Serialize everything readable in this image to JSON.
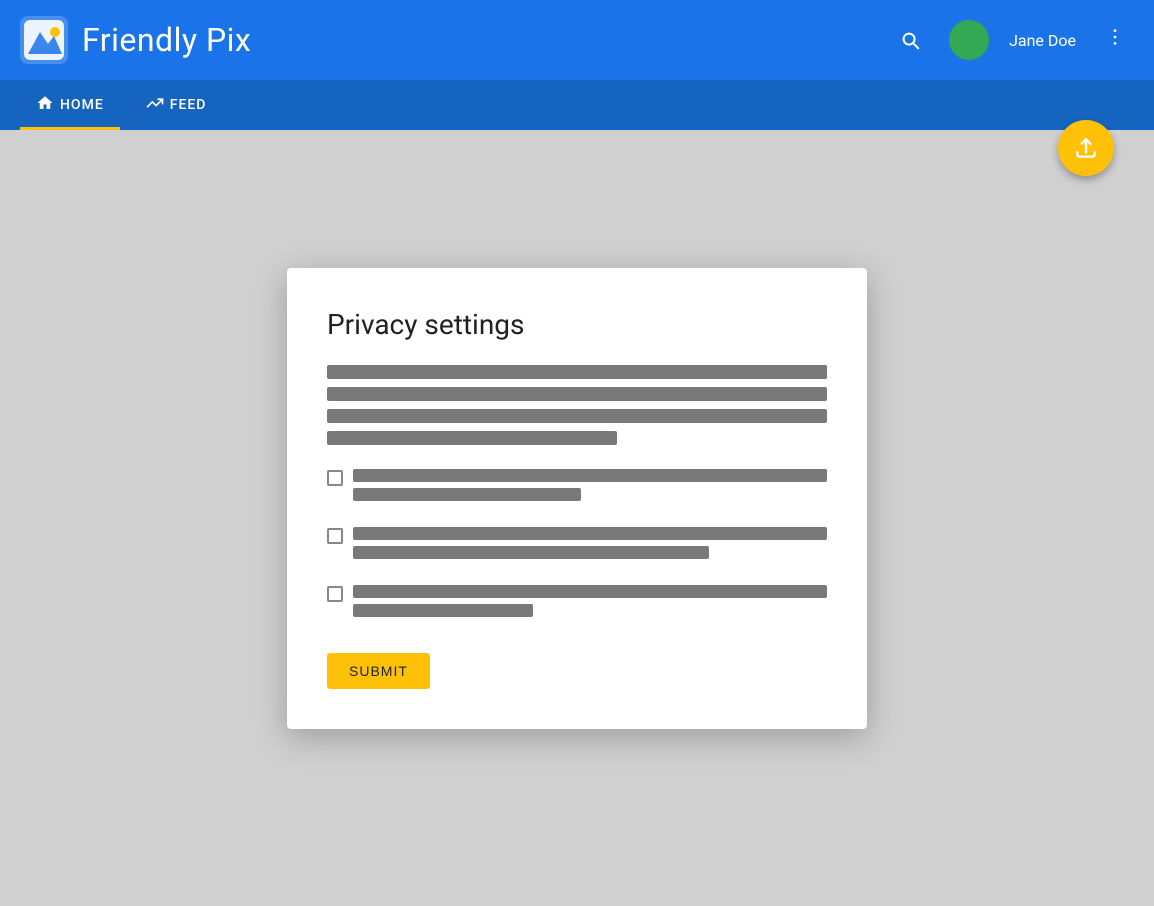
{
  "header": {
    "app_title": "Friendly Pix",
    "user_name": "Jane Doe",
    "avatar_color": "#34a853"
  },
  "navbar": {
    "home_label": "HOME",
    "feed_label": "FEED",
    "active_tab": "home"
  },
  "fab": {
    "icon": "↑",
    "label": "Upload"
  },
  "dialog": {
    "title": "Privacy settings",
    "submit_label": "SUBMIT",
    "description_lines": [
      "full",
      "full",
      "full",
      "partial"
    ],
    "checkboxes": [
      {
        "line1": "full",
        "line2": "med"
      },
      {
        "line1": "full",
        "line2": "long"
      },
      {
        "line1": "full",
        "line2": "long2"
      }
    ]
  }
}
